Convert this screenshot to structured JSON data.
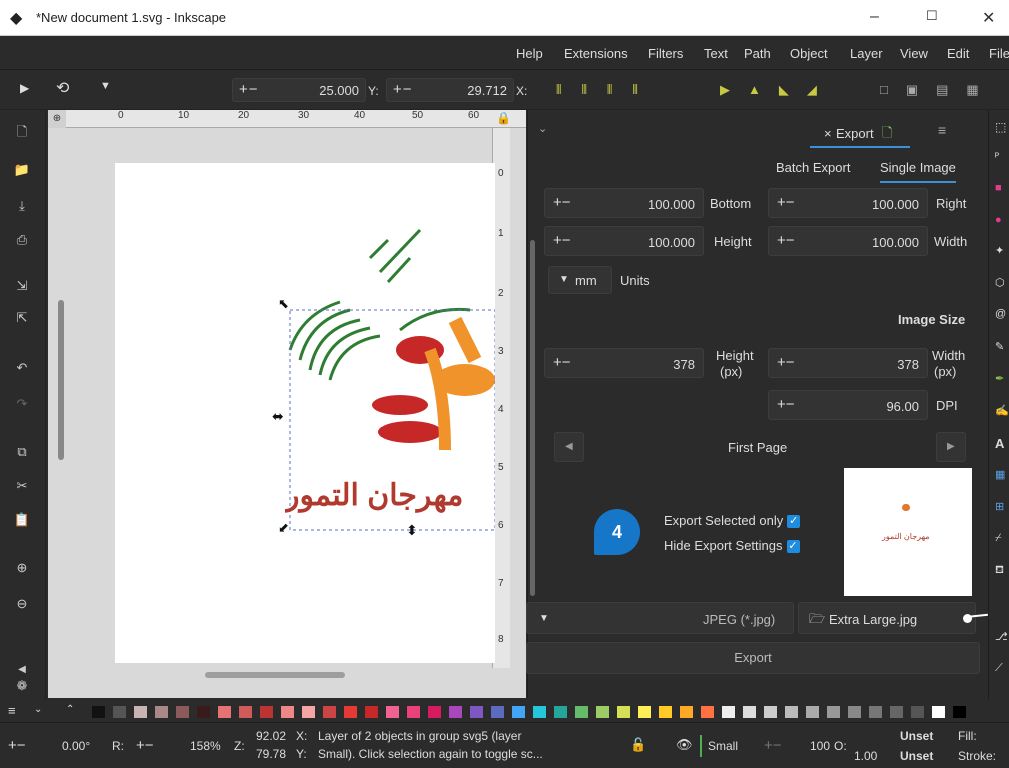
{
  "window": {
    "title": "*New document 1.svg - Inkscape",
    "minimize": "–",
    "maximize": "☐",
    "close": "✕"
  },
  "menu": [
    "Help",
    "Extensions",
    "Filters",
    "Text",
    "Path",
    "Object",
    "Layer",
    "View",
    "Edit",
    "File"
  ],
  "toolctrl": {
    "x_value": "25.000",
    "y_label": "Y:",
    "y_value": "29.712",
    "x_label": "X:",
    "pm": "+−"
  },
  "ruler_top": [
    "0",
    "10",
    "20",
    "30",
    "40",
    "50",
    "60"
  ],
  "ruler_left": [
    "0",
    "1",
    "2",
    "3",
    "4",
    "5",
    "6",
    "7",
    "8"
  ],
  "canvas": {
    "arabic_text": "مهرجان التمور"
  },
  "panel": {
    "tab_label": "Export",
    "tab_close": "×",
    "batch_export": "Batch Export",
    "single_image": "Single Image",
    "bottom_label": "Bottom",
    "bottom_value": "100.000",
    "right_label": "Right",
    "right_value": "100.000",
    "height_label": "Height",
    "height_value": "100.000",
    "width_label": "Width",
    "width_value": "100.000",
    "units_value": "mm",
    "units_label": "Units",
    "image_size": "Image Size",
    "height_px_value": "378",
    "height_px_label": "Height",
    "height_px_unit": "(px)",
    "width_px_value": "378",
    "width_px_label": "Width",
    "width_px_unit": "(px)",
    "dpi_value": "96.00",
    "dpi_label": "DPI",
    "first_page": "First Page",
    "export_selected": "Export Selected only",
    "hide_settings": "Hide Export Settings",
    "preview_text": "مهرجان التمور",
    "format": "JPEG (*.jpg)",
    "filename": "Extra Large.jpg",
    "export_button": "Export"
  },
  "badge": "4",
  "colors": {
    "accent": "#1677c8",
    "check": "#1f8ce0",
    "tab_underline": "#3d8fd8"
  },
  "status": {
    "rotate": "0.00°",
    "r_label": "R:",
    "zoom": "158%",
    "z_label": "Z:",
    "x_coord": "92.02",
    "y_coord": "79.78",
    "x_label": "X:",
    "y_label": "Y:",
    "msg_line1": "Layer of 2 objects in group svg5 (layer",
    "msg_line2": "Small). Click selection again to toggle sc...",
    "layer": "Small",
    "opacity": "100",
    "o_label": "O:",
    "opacity2": "1.00",
    "fill_label": "Fill:",
    "fill_value": "Unset",
    "stroke_label": "Stroke:",
    "stroke_value": "Unset"
  }
}
